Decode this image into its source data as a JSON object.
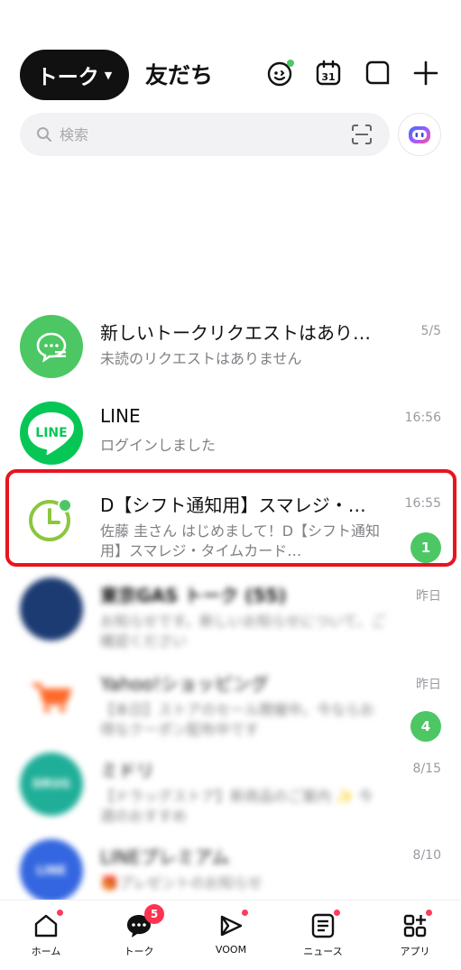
{
  "header": {
    "active_tab": "トーク",
    "other_tab": "友だち",
    "calendar_day": "31",
    "icons": [
      "sticker-icon",
      "calendar-icon",
      "note-icon",
      "plus-icon"
    ]
  },
  "search": {
    "placeholder": "検索"
  },
  "chats": [
    {
      "name": "新しいトークリクエストはあり…",
      "message": "未読のリクエストはありません",
      "time": "5/5",
      "unread": "",
      "avatar_color": "#4cc764",
      "avatar_label": ""
    },
    {
      "name": "LINE",
      "message": "ログインしました",
      "time": "16:56",
      "unread": "",
      "avatar_color": "#06c755",
      "avatar_label": "LINE"
    },
    {
      "name": "D【シフト通知用】スマレジ・…",
      "message": "佐藤 圭さん はじめまして！D【シフト通知用】スマレジ・タイムカード…",
      "time": "16:55",
      "unread": "1",
      "avatar_color": "#ffffff",
      "avatar_label": ""
    },
    {
      "name": "東京GAS トーク (55)",
      "message": "お知らせです。新しいお知らせについて、ご確認ください",
      "time": "昨日",
      "unread": "",
      "avatar_color": "#1c3b72",
      "avatar_label": ""
    },
    {
      "name": "Yahoo!ショッピング",
      "message": "【本日】ストアのセール開催中。今ならお得なクーポン配布中です",
      "time": "昨日",
      "unread": "4",
      "avatar_color": "#ffffff",
      "avatar_label": ""
    },
    {
      "name": "ミドリ",
      "message": "【ドラッグストア】新商品のご案内 ✨ 今週のおすすめ",
      "time": "8/15",
      "unread": "",
      "avatar_color": "#1fae98",
      "avatar_label": "DRUG"
    },
    {
      "name": "LINEプレミアム",
      "message": "🎁プレゼントのお知らせ",
      "time": "8/10",
      "unread": "",
      "avatar_color": "#3366e0",
      "avatar_label": "LINE"
    }
  ],
  "bottom_nav": {
    "home": "ホーム",
    "talk": "トーク",
    "talk_badge": "5",
    "voom": "VOOM",
    "news": "ニュース",
    "apps": "アプリ"
  },
  "colors": {
    "line_green": "#4cc764",
    "highlight_red": "#e8141e",
    "notification_red": "#ff3350"
  }
}
